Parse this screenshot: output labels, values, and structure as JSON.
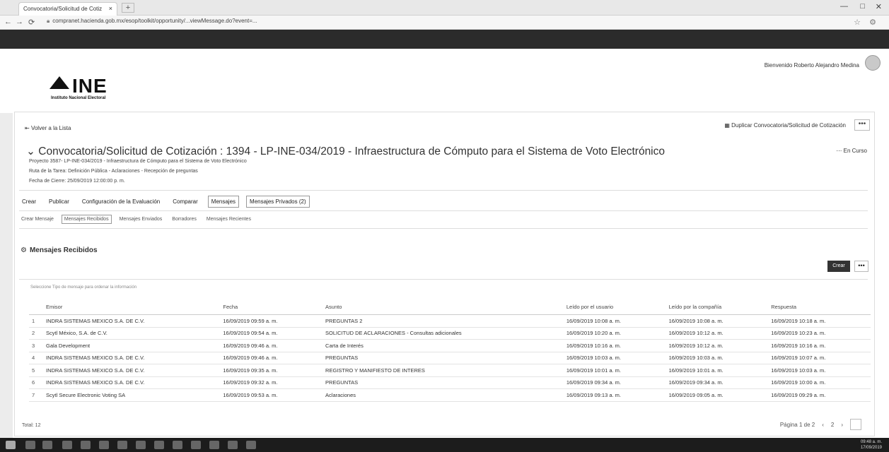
{
  "browser": {
    "tab_title": "Convocatoria/Solicitud de Cotiz",
    "tab_close": "×",
    "new_tab": "+",
    "url": "compranet.hacienda.gob.mx/esop/toolkit/opportunity/...viewMessage.do?event=...",
    "nav_back": "←",
    "nav_forward": "→",
    "nav_reload": "⟳",
    "star": "☆",
    "win_min": "—",
    "win_max": "□",
    "win_close": "✕"
  },
  "header": {
    "welcome": "Bienvenido Roberto Alejandro Medina",
    "logo_text": "INE",
    "logo_sub": "Instituto Nacional Electoral"
  },
  "page": {
    "back_link": "Volver a la Lista",
    "duplicate": "Duplicar Convocatoria/Solicitud de Cotización",
    "more": "•••",
    "title": "Convocatoria/Solicitud de Cotización : 1394 - LP-INE-034/2019 - Infraestructura de Cómputo para el Sistema de Voto Electrónico",
    "status": "En Curso",
    "project": "Proyecto 3587- LP-INE-034/2019 - Infraestructura de Cómputo para el Sistema de Voto Electrónico",
    "task_route": "Ruta de la Tarea: Definición Pública - Aclaraciones - Recepción de preguntas",
    "close_date": "Fecha de Cierre: 25/09/2019 12:00:00 p. m."
  },
  "menu1": [
    "Crear",
    "Publicar",
    "Configuración de la Evaluación",
    "Comparar",
    "Mensajes",
    "Mensajes Privados (2)"
  ],
  "menu2": [
    "Crear Mensaje",
    "Mensajes Recibidos",
    "Mensajes Enviados",
    "Borradores",
    "Mensajes Recientes"
  ],
  "section": {
    "title": "Mensajes Recibidos",
    "create_button": "Crear",
    "more": "•••",
    "hint": "Seleccione Tipo de mensaje para ordenar la información"
  },
  "table": {
    "headers": [
      "",
      "Emisor",
      "Fecha",
      "Asunto",
      "Leído por el usuario",
      "Leído por la compañía",
      "Respuesta"
    ],
    "rows": [
      [
        "1",
        "INDRA SISTEMAS MEXICO S.A. DE C.V.",
        "16/09/2019 09:59 a. m.",
        "PREGUNTAS 2",
        "16/09/2019 10:08 a. m.",
        "16/09/2019 10:08 a. m.",
        "16/09/2019 10:18 a. m."
      ],
      [
        "2",
        "Scytl México, S.A. de C.V.",
        "16/09/2019 09:54 a. m.",
        "SOLICITUD DE ACLARACIONES - Consultas adicionales",
        "16/09/2019 10:20 a. m.",
        "16/09/2019 10:12 a. m.",
        "16/09/2019 10:23 a. m."
      ],
      [
        "3",
        "Gala Development",
        "16/09/2019 09:46 a. m.",
        "Carta de Interés",
        "16/09/2019 10:16 a. m.",
        "16/09/2019 10:12 a. m.",
        "16/09/2019 10:16 a. m."
      ],
      [
        "4",
        "INDRA SISTEMAS MEXICO S.A. DE C.V.",
        "16/09/2019 09:46 a. m.",
        "PREGUNTAS",
        "16/09/2019 10:03 a. m.",
        "16/09/2019 10:03 a. m.",
        "16/09/2019 10:07 a. m."
      ],
      [
        "5",
        "INDRA SISTEMAS MEXICO S.A. DE C.V.",
        "16/09/2019 09:35 a. m.",
        "REGISTRO Y MANIFIESTO DE INTERES",
        "16/09/2019 10:01 a. m.",
        "16/09/2019 10:01 a. m.",
        "16/09/2019 10:03 a. m."
      ],
      [
        "6",
        "INDRA SISTEMAS MEXICO S.A. DE C.V.",
        "16/09/2019 09:32 a. m.",
        "PREGUNTAS",
        "16/09/2019 09:34 a. m.",
        "16/09/2019 09:34 a. m.",
        "16/09/2019 10:00 a. m."
      ],
      [
        "7",
        "Scytl Secure Electronic Voting SA",
        "16/09/2019 09:53 a. m.",
        "Aclaraciones",
        "16/09/2019 09:13 a. m.",
        "16/09/2019 09:05 a. m.",
        "16/09/2019 09:29 a. m."
      ]
    ]
  },
  "footer": {
    "total": "Total: 12",
    "pages": "Página 1 de 2",
    "prev": "‹",
    "page2": "2",
    "next": "›"
  },
  "taskbar": {
    "time": "09:48 a. m.",
    "date": "17/09/2019"
  }
}
